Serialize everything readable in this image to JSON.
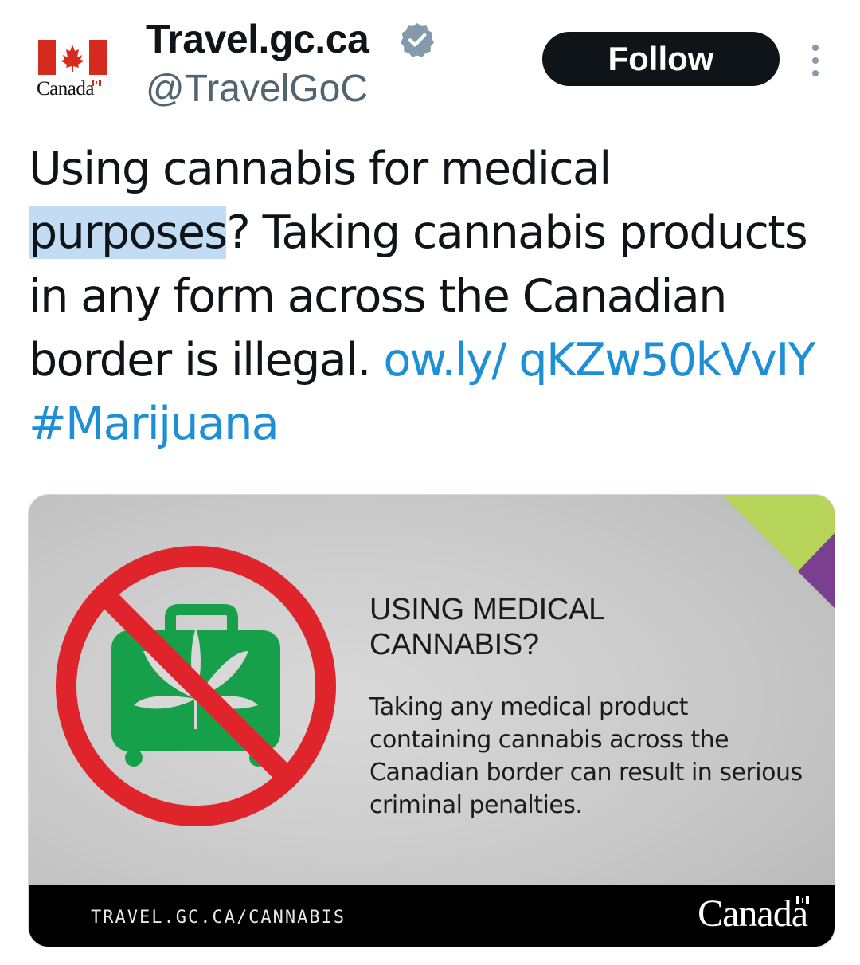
{
  "account": {
    "display_name": "Travel.gc.ca",
    "handle": "@TravelGoC",
    "verified": true,
    "avatar_wordmark": "Canada"
  },
  "actions": {
    "follow_label": "Follow"
  },
  "tweet": {
    "text_before": "Using cannabis for medical ",
    "text_highlight": "purposes",
    "text_after": "? Taking cannabis products in any form across the Canadian border is illegal. ",
    "link": "ow.ly/ qKZw50kVvIY",
    "hashtag": "#Marijuana"
  },
  "media": {
    "title": "USING MEDICAL\nCANNABIS?",
    "body": "Taking any medical product containing cannabis across the Canadian border can result in serious criminal penalties.",
    "footer_url": "TRAVEL.GC.CA/CANNABIS",
    "footer_wordmark": "Canada"
  },
  "colors": {
    "link": "#1d8fd6",
    "follow_bg": "#0f1419",
    "prohibition_red": "#e0242b",
    "suitcase_green": "#16a04a",
    "accent_lime": "#b6d35a",
    "accent_purple": "#7a3f8f",
    "canada_red": "#d52b1e"
  },
  "icons": [
    "canada-flag-icon",
    "verified-badge-icon",
    "more-options-icon",
    "no-cannabis-suitcase-icon"
  ]
}
